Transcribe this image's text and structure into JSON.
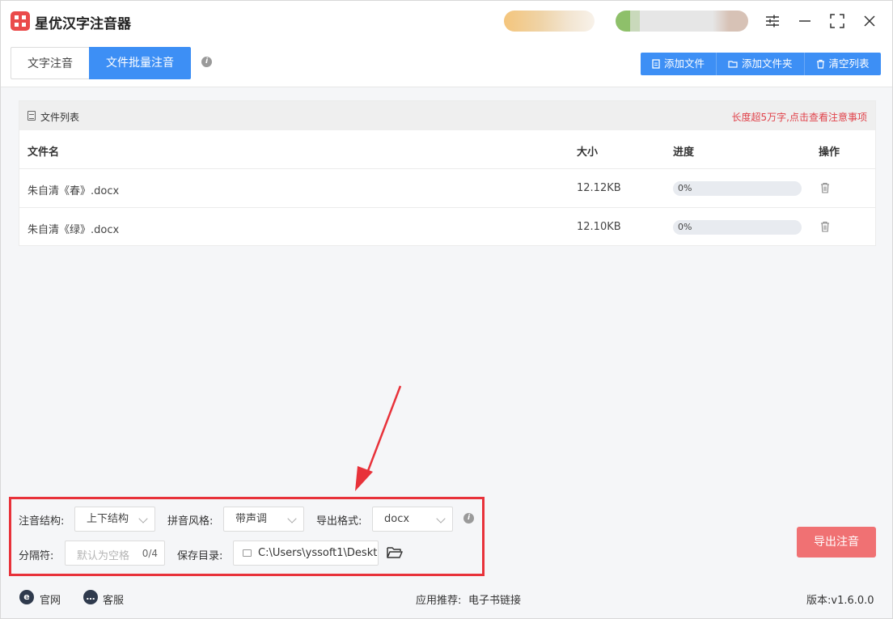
{
  "app": {
    "title": "星优汉字注音器"
  },
  "tabs": [
    {
      "label": "文字注音",
      "active": false
    },
    {
      "label": "文件批量注音",
      "active": true
    }
  ],
  "toolbar": {
    "add_file": "添加文件",
    "add_folder": "添加文件夹",
    "clear_list": "清空列表"
  },
  "file_list": {
    "title": "文件列表",
    "hint": "长度超5万字,点击查看注意事项",
    "columns": {
      "name": "文件名",
      "size": "大小",
      "progress": "进度",
      "action": "操作"
    },
    "rows": [
      {
        "name": "朱自清《春》.docx",
        "size": "12.12KB",
        "progress_text": "0%",
        "progress": 0
      },
      {
        "name": "朱自清《绿》.docx",
        "size": "12.10KB",
        "progress_text": "0%",
        "progress": 0
      }
    ]
  },
  "settings": {
    "structure_label": "注音结构:",
    "structure_value": "上下结构",
    "pinyin_style_label": "拼音风格:",
    "pinyin_style_value": "带声调",
    "export_format_label": "导出格式:",
    "export_format_value": "docx",
    "separator_label": "分隔符:",
    "separator_placeholder": "默认为空格",
    "separator_count": "0/4",
    "save_dir_label": "保存目录:",
    "save_dir_value": "C:\\Users\\yssoft1\\Deskt"
  },
  "export_button": "导出注音",
  "footer": {
    "website": "官网",
    "support": "客服",
    "recommend_label": "应用推荐:",
    "recommend_link": "电子书链接",
    "version": "版本:v1.6.0.0"
  },
  "colors": {
    "primary": "#3d8ff5",
    "danger": "#e8323a",
    "export": "#f07173",
    "hint": "#e0424a"
  }
}
